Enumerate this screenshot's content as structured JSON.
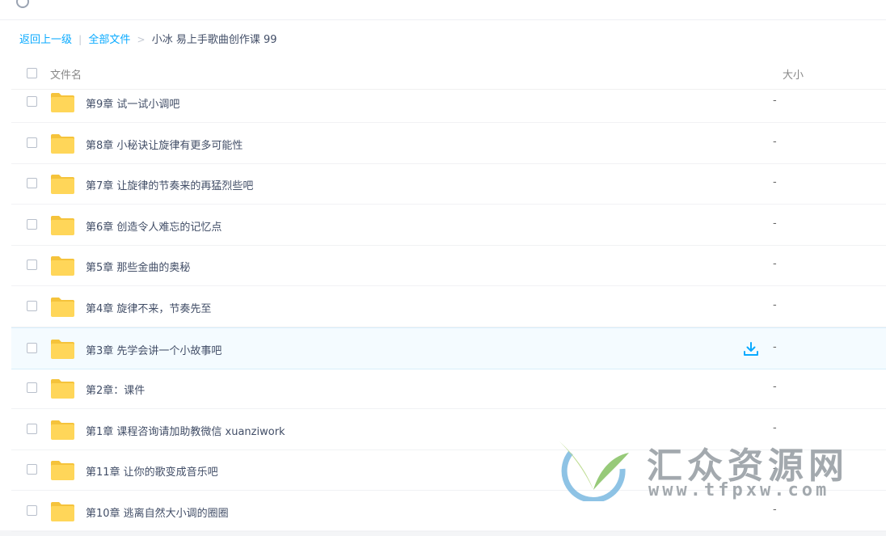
{
  "breadcrumb": {
    "back": "返回上一级",
    "divider": "|",
    "all_files": "全部文件",
    "arrow": ">",
    "current": "小冰 易上手歌曲创作课 99"
  },
  "header": {
    "name_label": "文件名",
    "size_label": "大小"
  },
  "files": [
    {
      "name": "第9章 试一试小调吧",
      "size": "-"
    },
    {
      "name": "第8章 小秘诀让旋律有更多可能性",
      "size": "-"
    },
    {
      "name": "第7章 让旋律的节奏来的再猛烈些吧",
      "size": "-"
    },
    {
      "name": "第6章 创造令人难忘的记忆点",
      "size": "-"
    },
    {
      "name": "第5章 那些金曲的奥秘",
      "size": "-"
    },
    {
      "name": "第4章 旋律不来，节奏先至",
      "size": "-"
    },
    {
      "name": "第3章 先学会讲一个小故事吧",
      "size": "-",
      "hovered": true
    },
    {
      "name": "第2章：课件",
      "size": "-"
    },
    {
      "name": "第1章 课程咨询请加助教微信 xuanziwork",
      "size": "-"
    },
    {
      "name": "第11章 让你的歌变成音乐吧",
      "size": "-"
    },
    {
      "name": "第10章 逃离自然大小调的圈圈",
      "size": "-"
    }
  ],
  "watermark": {
    "title": "汇众资源网",
    "url": "www.tfpxw.com"
  },
  "icons": {
    "folder": "folder-icon",
    "download": "download-icon",
    "checkbox": "checkbox-icon",
    "clock": "clock-icon"
  },
  "colors": {
    "accent": "#09aaff",
    "folder": "#ffd659",
    "folder_tab": "#f5c33b",
    "hover_bg": "#f4fbff"
  }
}
